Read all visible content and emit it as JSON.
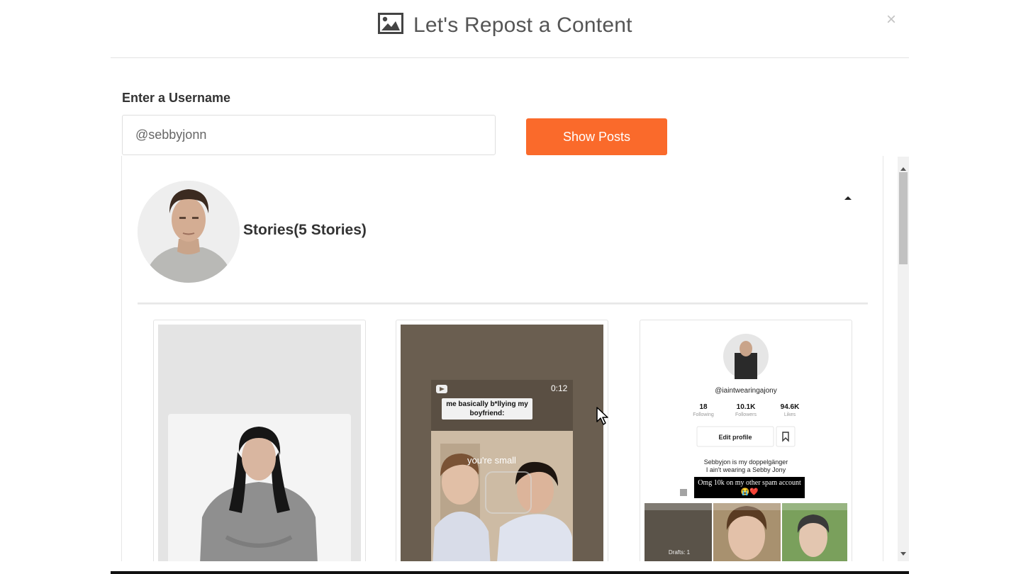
{
  "header": {
    "title": "Let's Repost a Content",
    "image_icon": "image-icon",
    "close_symbol": "×"
  },
  "form": {
    "label": "Enter a Username",
    "username_value": "@sebbyjonn",
    "button_label": "Show Posts"
  },
  "stories": {
    "heading": "Stories(5 Stories)",
    "caret_icon": "caret-up-icon"
  },
  "cards": [
    {
      "kind": "photo",
      "description_icon": "photo-thumbnail"
    },
    {
      "kind": "video",
      "duration": "0:12",
      "caption": "me basically b*llying my boyfriend:",
      "subtitle": "you're small"
    },
    {
      "kind": "profile-screenshot",
      "handle": "@iaintwearingajony",
      "following_count": "18",
      "following_label": "Following",
      "followers_count": "10.1K",
      "followers_label": "Followers",
      "likes_count": "94.6K",
      "likes_label": "Likes",
      "edit_profile": "Edit profile",
      "bio_line1": "Sebbyjon is my doppelgänger",
      "bio_line2": "I ain't wearing a Sebby Jony",
      "comment": "Omg 10k on my other spam account 😭❤️",
      "drafts": "Drafts: 1"
    }
  ],
  "colors": {
    "accent": "#fa6a2b",
    "text": "#333333",
    "border": "#dedede"
  }
}
